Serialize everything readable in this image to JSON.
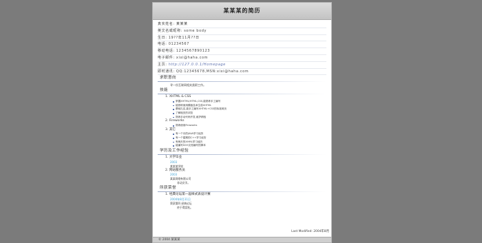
{
  "title": "某某某的简历",
  "info": [
    {
      "label": "真实姓名:",
      "value": "某某某"
    },
    {
      "label": "英文名或昵称:",
      "value": "some body"
    },
    {
      "label": "生日:",
      "value": "19??年11月??日"
    },
    {
      "label": "电话:",
      "value": "01234567"
    },
    {
      "label": "移动电话:",
      "value": "1234567890123"
    },
    {
      "label": "电子邮件:",
      "value": "xixi@haha.com"
    },
    {
      "label": "主页:",
      "value": "http://127.0.0.1/Homepage"
    },
    {
      "label": "即时通讯:",
      "value": "QQ:12345678,MSN:xixi@haha.com"
    }
  ],
  "objective": {
    "heading": "求职意向",
    "text": "寻一份互联网相关类职工作。"
  },
  "skills": {
    "heading": "技能",
    "groups": [
      {
        "title": "1. XHTML & CSS",
        "items": [
          "掌握XHTML/HTML,CSS,能熟练手工编写",
          "能熟练使用模板技术生成XHTML",
          "基础扎实,能手工编写XHTML+CSS的标准网页",
          "了解相关的浏览",
          "熟练手动代码开发,维护精验"
        ]
      },
      {
        "title": "2. Fireworks",
        "items": [
          "熟练使用Fireworks"
        ]
      },
      {
        "title": "3. 其它",
        "items": [
          "有一个月的JAVA学习经历",
          "有一个星期的C++学习经历",
          "有两天的XHML学习经历",
          "能编写DOS文档编写的脚本"
        ]
      }
    ]
  },
  "education": {
    "heading": "学历及工作经验",
    "items": [
      {
        "title": "1. 大学毕业",
        "date": "2003",
        "lines": [
          "某某某学校"
        ]
      },
      {
        "title": "2. 网站服务员",
        "date": "2003",
        "lines": [
          "某某网络有限公司"
        ],
        "extra": "非动文字。"
      }
    ]
  },
  "awards": {
    "heading": "所获荣誉",
    "items": [
      {
        "title": "1. 经典论坛第一届样式表设计赛",
        "date": "2004年8月31日",
        "lines": [
          "荣获第四 经典论坛"
        ],
        "extra": "终于得奖啦。"
      }
    ]
  },
  "last_modified": "Last Modified: 2004年8月",
  "footer": "© 2004 某某某",
  "colors": {
    "background": "#7b7b7b",
    "page": "#ffffff",
    "header": "#c9c9c9",
    "date_blue": "#3fa3d6",
    "bullet": "#3c5aa0"
  }
}
